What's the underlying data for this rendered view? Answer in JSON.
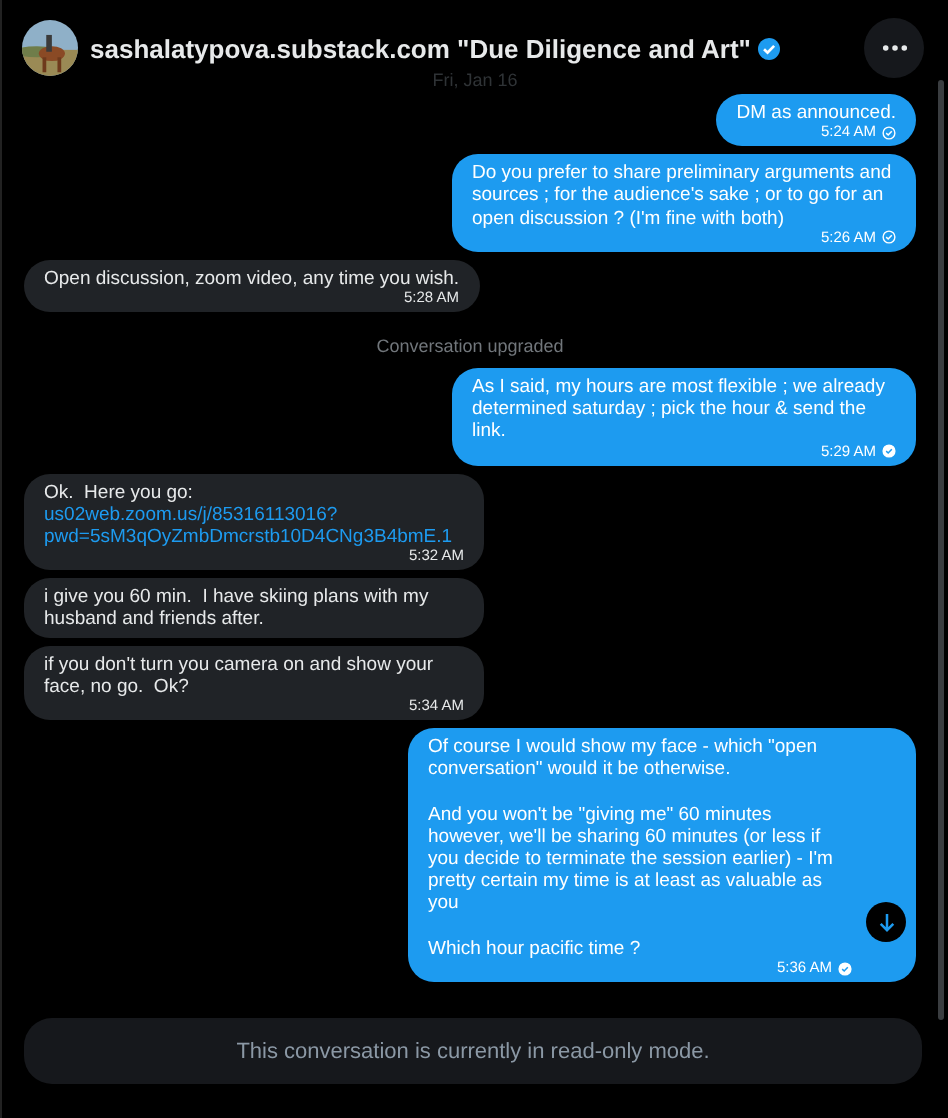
{
  "header": {
    "title": "sashalatypova.substack.com \"Due Diligence and Art\"",
    "verified": true,
    "date": "Fri, Jan 16"
  },
  "messages": [
    {
      "kind": "sent",
      "text": "DM as announced.",
      "time": "5:24 AM",
      "read": false
    },
    {
      "kind": "sent",
      "text": "Do you prefer to share preliminary arguments and sources ; for the audience's sake ; or to go for an open discussion ? (I'm fine with both)",
      "time": "5:26 AM",
      "read": false
    },
    {
      "kind": "received",
      "text": "Open discussion, zoom video, any time you wish.",
      "time": "5:28 AM"
    },
    {
      "kind": "notice",
      "text": "Conversation upgraded"
    },
    {
      "kind": "sent",
      "text": "As I said, my hours are most flexible ; we already determined saturday ; pick the hour & send the link.",
      "time": "5:29 AM",
      "read": true
    },
    {
      "kind": "received",
      "text": "Ok.  Here you go:",
      "link": "us02web.zoom.us/j/85316113016?pwd=5sM3qOyZmbDmcrstb10D4CNg3B4bmE.1",
      "time": "5:32 AM"
    },
    {
      "kind": "received",
      "text": "i give you 60 min.  I have skiing plans with my husband and friends after."
    },
    {
      "kind": "received",
      "text": "if you don't turn you camera on and show your face, no go.  Ok?",
      "time": "5:34 AM"
    },
    {
      "kind": "sent",
      "text": "Of course I would show my face - which \"open conversation\" would it be otherwise.\n\nAnd you won't be \"giving me\" 60 minutes however, we'll be sharing 60 minutes (or less if you decide to terminate the session earlier) - I'm pretty certain my time is at least as valuable as you\n\nWhich hour pacific time ?",
      "time": "5:36 AM",
      "read": true
    }
  ],
  "footer": {
    "text": "This conversation is currently in read-only mode."
  }
}
